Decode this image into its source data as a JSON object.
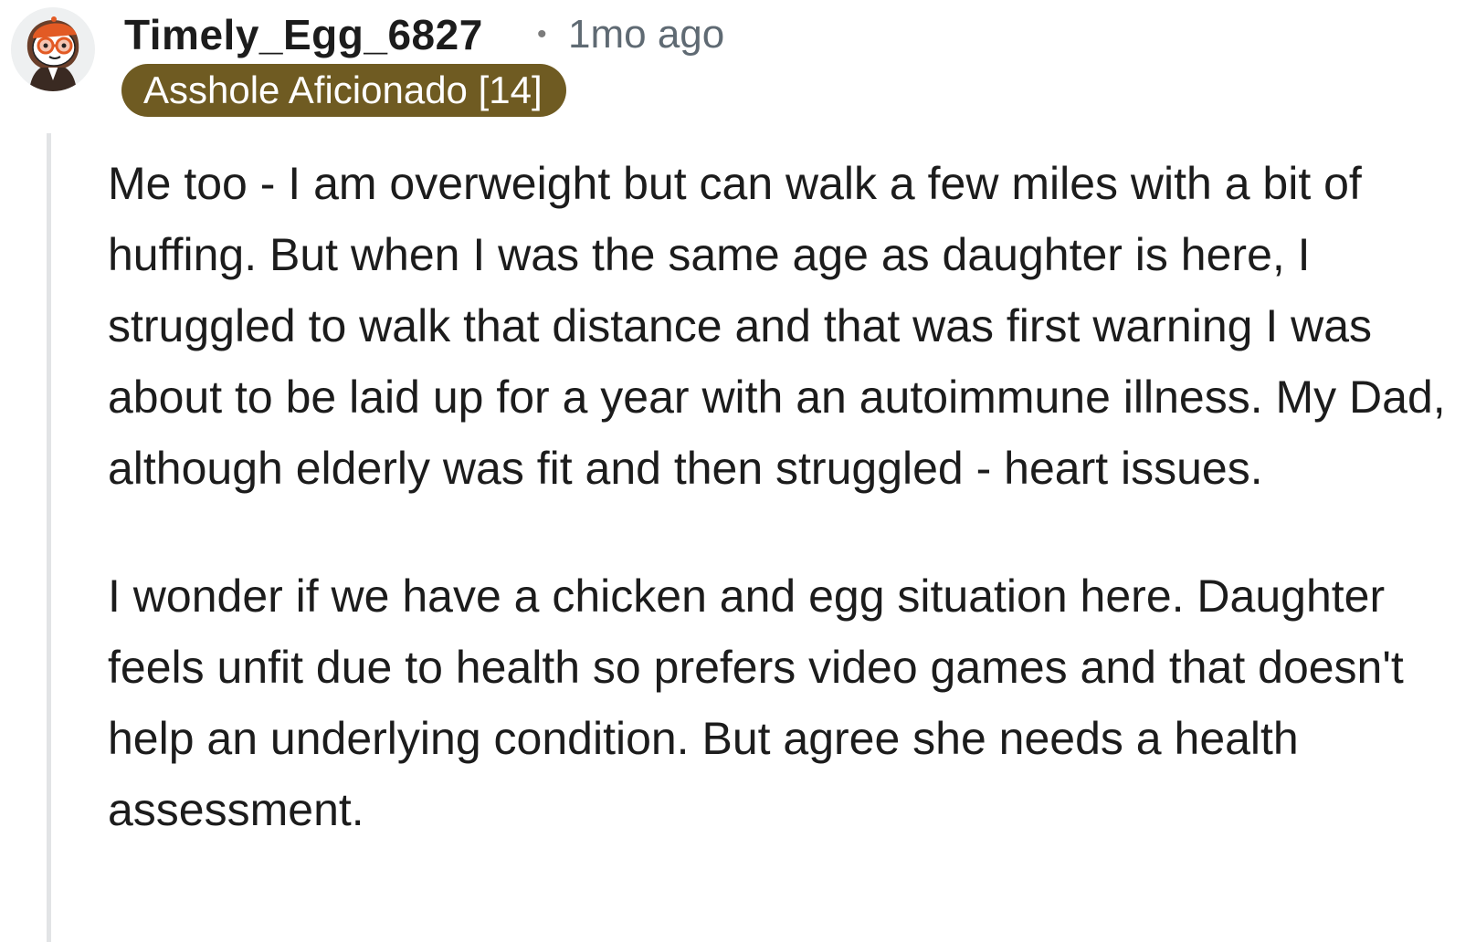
{
  "comment": {
    "avatar_icon": "snoo-avatar-icon",
    "username": "Timely_Egg_6827",
    "separator": "•",
    "timestamp": "1mo ago",
    "flair": {
      "label": "Asshole Aficionado [14]",
      "color": "#6f5b22"
    },
    "paragraphs": [
      "Me too - I am overweight but can walk a few miles with a bit of huffing. But when I was the same age as daughter is here, I struggled to walk that distance and that was first warning I was about to be laid up for a year with an autoimmune illness. My Dad, although elderly was fit and then struggled - heart issues.",
      "I wonder if we have a chicken and egg situation here. Daughter feels unfit due to health so prefers video games and that doesn't help an underlying condition. But agree she needs a health assessment."
    ]
  },
  "colors": {
    "text": "#1c1c1c",
    "meta": "#5f6a73",
    "flair_bg": "#6f5b22",
    "thread_line": "#e2e4e6"
  }
}
